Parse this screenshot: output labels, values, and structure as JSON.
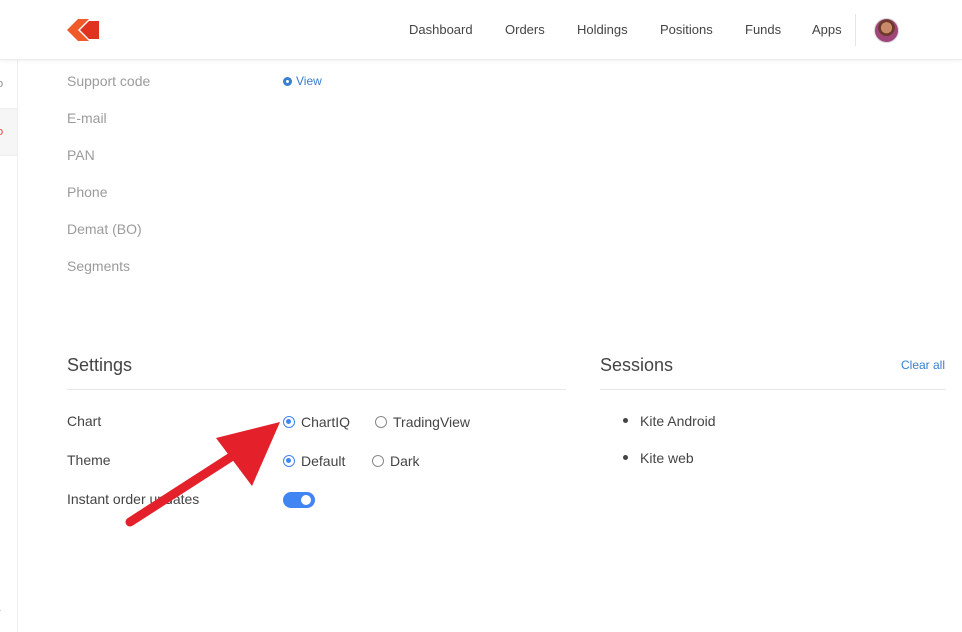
{
  "nav": {
    "items": [
      "Dashboard",
      "Orders",
      "Holdings",
      "Positions",
      "Funds",
      "Apps"
    ]
  },
  "profile": {
    "rows": [
      "Support code",
      "E-mail",
      "PAN",
      "Phone",
      "Demat (BO)",
      "Segments"
    ],
    "support_code_action": "View"
  },
  "settings": {
    "title": "Settings",
    "chart": {
      "label": "Chart",
      "options": [
        "ChartIQ",
        "TradingView"
      ],
      "selected": "ChartIQ"
    },
    "theme": {
      "label": "Theme",
      "options": [
        "Default",
        "Dark"
      ],
      "selected": "Default"
    },
    "instant_updates": {
      "label": "Instant order updates",
      "enabled": true
    }
  },
  "sessions": {
    "title": "Sessions",
    "clear_label": "Clear all",
    "items": [
      "Kite Android",
      "Kite web"
    ]
  },
  "left_strip": {
    "glyphs": [
      "o",
      "o",
      "}"
    ]
  },
  "colors": {
    "brand": "#f05a28",
    "accent": "#387ed1",
    "toggle": "#4184f3",
    "annotation": "#e4202a"
  }
}
